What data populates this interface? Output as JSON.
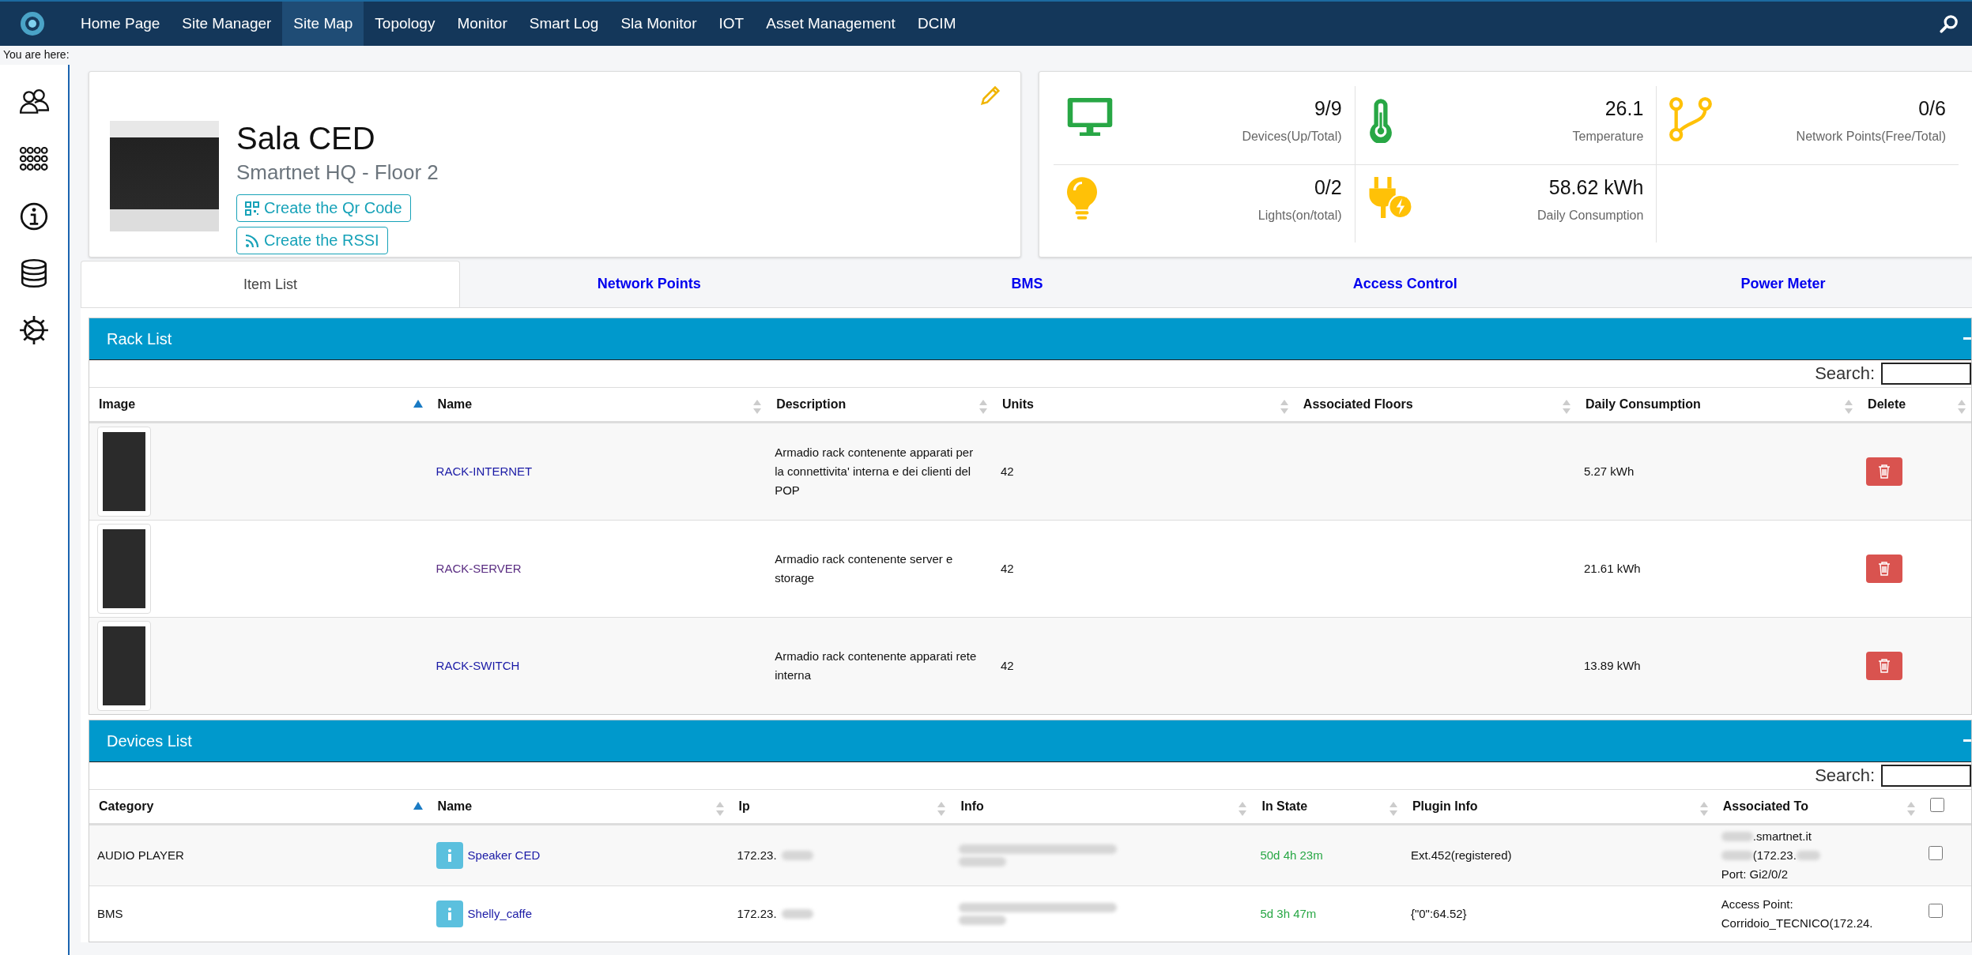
{
  "nav": {
    "items": [
      {
        "label": "Home Page",
        "selected": false
      },
      {
        "label": "Site Manager",
        "selected": false
      },
      {
        "label": "Site Map",
        "selected": true
      },
      {
        "label": "Topology",
        "selected": false
      },
      {
        "label": "Monitor",
        "selected": false
      },
      {
        "label": "Smart Log",
        "selected": false
      },
      {
        "label": "Sla Monitor",
        "selected": false
      },
      {
        "label": "IOT",
        "selected": false
      },
      {
        "label": "Asset Management",
        "selected": false
      },
      {
        "label": "DCIM",
        "selected": false
      }
    ]
  },
  "breadcrumb": "You are here:",
  "site": {
    "title": "Sala CED",
    "subtitle": "Smartnet HQ - Floor 2",
    "buttons": [
      {
        "label": "Create the Qr Code",
        "kind": "qr"
      },
      {
        "label": "Create the RSSI",
        "kind": "rssi"
      }
    ]
  },
  "stats": [
    {
      "value": "9/9",
      "label": "Devices(Up/Total)",
      "kind": "monitor",
      "color": "#28a745"
    },
    {
      "value": "26.1",
      "label": "Temperature",
      "kind": "thermometer",
      "color": "#28a745"
    },
    {
      "value": "0/6",
      "label": "Network Points(Free/Total)",
      "kind": "branch",
      "color": "#ffc107"
    },
    {
      "value": "0/2",
      "label": "Lights(on/total)",
      "kind": "bulb",
      "color": "#ffc107"
    },
    {
      "value": "58.62 kWh",
      "label": "Daily Consumption",
      "kind": "plug",
      "color": "#ffc107"
    }
  ],
  "tabs": [
    {
      "label": "Item List",
      "selected": true
    },
    {
      "label": "Network Points",
      "selected": false
    },
    {
      "label": "BMS",
      "selected": false
    },
    {
      "label": "Access Control",
      "selected": false
    },
    {
      "label": "Power Meter",
      "selected": false
    }
  ],
  "rack_list": {
    "title": "Rack List",
    "search_label": "Search:",
    "columns": [
      {
        "label": "Image",
        "sorted": true
      },
      {
        "label": "Name",
        "sorted": false
      },
      {
        "label": "Description",
        "sorted": false
      },
      {
        "label": "Units",
        "sorted": false
      },
      {
        "label": "Associated Floors",
        "sorted": false
      },
      {
        "label": "Daily Consumption",
        "sorted": false
      },
      {
        "label": "Delete",
        "sorted": false
      }
    ],
    "rows": [
      {
        "name": "RACK-INTERNET",
        "visited": false,
        "description": "Armadio rack contenente apparati per la connettivita' interna e dei clienti del POP",
        "units": "42",
        "consumption": "5.27 kWh"
      },
      {
        "name": "RACK-SERVER",
        "visited": true,
        "description": "Armadio rack contenente server e storage",
        "units": "42",
        "consumption": "21.61 kWh"
      },
      {
        "name": "RACK-SWITCH",
        "visited": false,
        "description": "Armadio rack contenente apparati rete interna",
        "units": "42",
        "consumption": "13.89 kWh"
      }
    ]
  },
  "devices_list": {
    "title": "Devices List",
    "search_label": "Search:",
    "columns": [
      {
        "label": "Category",
        "sorted": true
      },
      {
        "label": "Name",
        "sorted": false
      },
      {
        "label": "Ip",
        "sorted": false
      },
      {
        "label": "Info",
        "sorted": false
      },
      {
        "label": "In State",
        "sorted": false
      },
      {
        "label": "Plugin Info",
        "sorted": false
      },
      {
        "label": "Associated To",
        "sorted": false
      }
    ],
    "select_all": {
      "checked": false
    },
    "rows": [
      {
        "category": "AUDIO PLAYER",
        "name": "Speaker CED",
        "ip": "172.23.",
        "in_state": "50d 4h 23m",
        "plugin_info": "Ext.452(registered)",
        "associated_to": [
          ".smartnet.it",
          "(172.23.",
          "Port: Gi2/0/2"
        ],
        "checked": false
      },
      {
        "category": "BMS",
        "name": "Shelly_caffe",
        "ip": "172.23.",
        "in_state": "5d 3h 47m",
        "plugin_info": "{\"0\":64.52}",
        "associated_to": [
          "Access Point:",
          "Corridoio_TECNICO(172.24."
        ],
        "checked": false
      }
    ]
  }
}
